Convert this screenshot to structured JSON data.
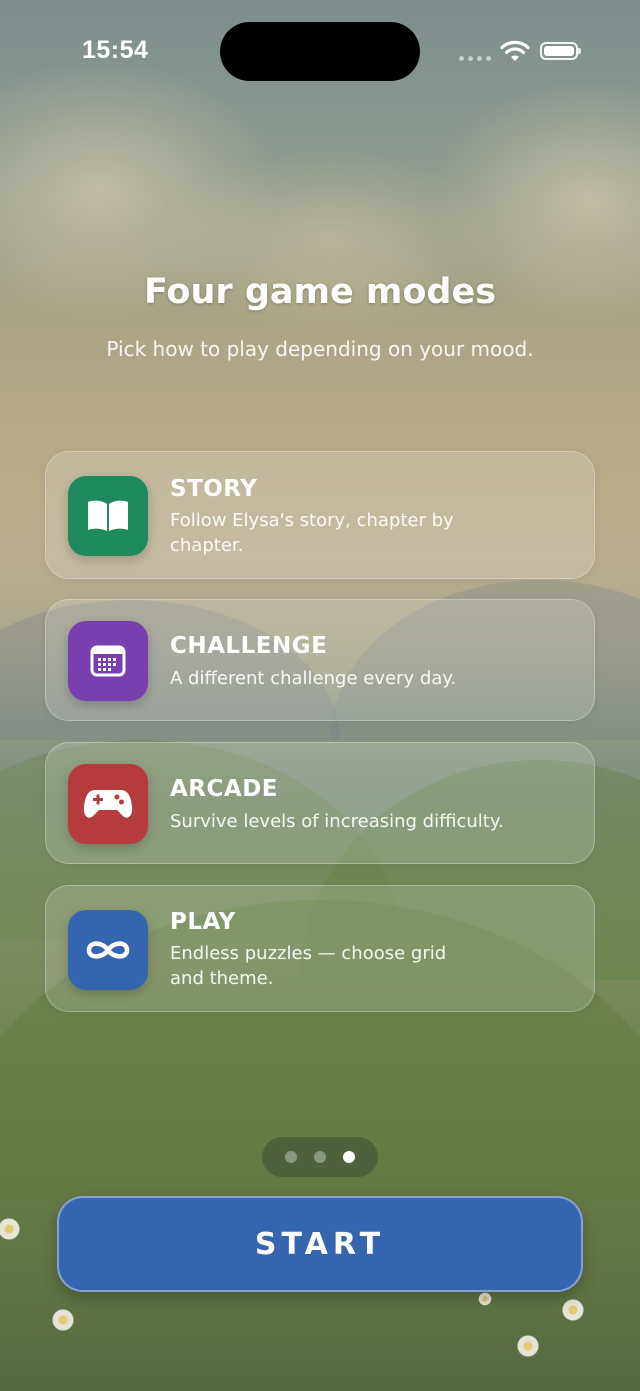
{
  "status_bar": {
    "time": "15:54"
  },
  "header": {
    "title": "Four game modes",
    "subtitle": "Pick how to play depending on your mood."
  },
  "modes": [
    {
      "label": "STORY",
      "description": "Follow Elysa's story, chapter by chapter.",
      "icon": "open-book-icon",
      "color": "#1f8a5e"
    },
    {
      "label": "CHALLENGE",
      "description": "A different challenge every day.",
      "icon": "calendar-icon",
      "color": "#7a3fae"
    },
    {
      "label": "ARCADE",
      "description": "Survive levels of increasing difficulty.",
      "icon": "gamepad-icon",
      "color": "#b53b3c"
    },
    {
      "label": "PLAY",
      "description": "Endless puzzles — choose grid and theme.",
      "icon": "infinity-icon",
      "color": "#3465ae"
    }
  ],
  "pager": {
    "page_count": 3,
    "current_page": 3
  },
  "start_button": {
    "label": "START",
    "color": "#3465ae"
  }
}
